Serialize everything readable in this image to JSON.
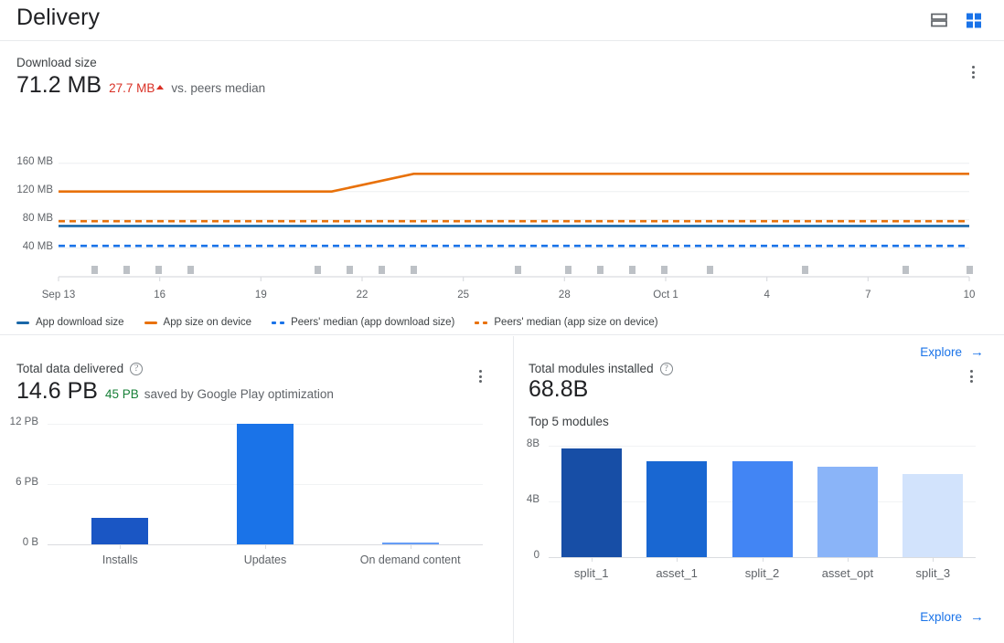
{
  "header": {
    "title": "Delivery",
    "view_toggles": [
      {
        "name": "list-view-toggle",
        "label": "List view",
        "selected": false
      },
      {
        "name": "grid-view-toggle",
        "label": "Grid view",
        "selected": true
      }
    ]
  },
  "download_size_card": {
    "label": "Download size",
    "value": "71.2 MB",
    "delta": "27.7 MB",
    "delta_direction": "up",
    "delta_note": "vs. peers median",
    "menu_label": "More options",
    "explore_label": "Explore",
    "explore_arrow": "→"
  },
  "total_data_card": {
    "label": "Total data delivered",
    "help_label": "?",
    "value": "14.6 PB",
    "saved": "45 PB",
    "saved_note": "saved by Google Play optimization",
    "menu_label": "More options"
  },
  "total_modules_card": {
    "label": "Total modules installed",
    "help_label": "?",
    "value": "68.8B",
    "subtitle": "Top 5 modules",
    "menu_label": "More options",
    "explore_label": "Explore",
    "explore_arrow": "→"
  },
  "colors": {
    "app_download_size": "#1a73e8",
    "app_download_size_line": "#1967a8",
    "app_size_on_device": "#e8710a",
    "peers_median_download": "#1a73e8",
    "peers_median_device": "#e8710a",
    "accent_blue": "#1a73e8",
    "negative_red": "#d93025",
    "positive_green": "#188038",
    "gridline": "#f1f3f4",
    "bar_installs": "#1a56c4",
    "bar_updates": "#1a73e8",
    "bar_ondemand": "#669df6",
    "module_colors": [
      "#174ea6",
      "#1967d2",
      "#4285f4",
      "#8ab4f8",
      "#d2e3fc"
    ]
  },
  "chart_data": [
    {
      "type": "line",
      "name": "download-size-over-time",
      "title": "Download size",
      "xlabel": "",
      "ylabel": "",
      "ylim": [
        20,
        170
      ],
      "yticks": [
        40,
        80,
        120,
        160
      ],
      "ytick_labels": [
        "40 MB",
        "80 MB",
        "120 MB",
        "160 MB"
      ],
      "xtick_labels": [
        "Sep 13",
        "16",
        "19",
        "22",
        "25",
        "28",
        "Oct 1",
        "4",
        "7",
        "10"
      ],
      "grid": true,
      "legend_position": "bottom-left",
      "series": [
        {
          "name": "App download size",
          "style": "solid",
          "color": "#1967a8",
          "constant": 71.2
        },
        {
          "name": "App size on device",
          "style": "solid",
          "color": "#e8710a",
          "points": [
            [
              0,
              120
            ],
            [
              0.3,
              120
            ],
            [
              0.39,
              145
            ],
            [
              1,
              145
            ]
          ]
        },
        {
          "name": "Peers' median (app download size)",
          "style": "dashed",
          "color": "#1a73e8",
          "constant": 43
        },
        {
          "name": "Peers' median (app size on device)",
          "style": "dashed",
          "color": "#e8710a",
          "constant": 78
        }
      ],
      "release_markers_pct": [
        4.0,
        7.5,
        11.0,
        14.5,
        28.5,
        32.0,
        35.5,
        39.0,
        50.5,
        56.0,
        59.5,
        63.0,
        66.5,
        71.5,
        82.0,
        93.0,
        100.0
      ]
    },
    {
      "type": "bar",
      "name": "total-data-delivered",
      "title": "Total data delivered",
      "categories": [
        "Installs",
        "Updates",
        "On demand content"
      ],
      "values": [
        2.6,
        12.0,
        0.12
      ],
      "value_labels": [
        "2.6 PB",
        "12 PB",
        "0.12 PB"
      ],
      "colors": [
        "#1a56c4",
        "#1a73e8",
        "#669df6"
      ],
      "ylabel": "",
      "xlabel": "",
      "ylim": [
        0,
        12
      ],
      "yticks": [
        0,
        6,
        12
      ],
      "ytick_labels": [
        "0 B",
        "6 PB",
        "12 PB"
      ],
      "grid": true
    },
    {
      "type": "bar",
      "name": "top-5-modules",
      "title": "Top 5 modules",
      "categories": [
        "split_1",
        "asset_1",
        "split_2",
        "asset_opt",
        "split_3"
      ],
      "values": [
        7.8,
        6.9,
        6.9,
        6.5,
        6.0
      ],
      "colors": [
        "#174ea6",
        "#1967d2",
        "#4285f4",
        "#8ab4f8",
        "#d2e3fc"
      ],
      "ylabel": "",
      "xlabel": "",
      "ylim": [
        0,
        8
      ],
      "yticks": [
        0,
        4,
        8
      ],
      "ytick_labels": [
        "0",
        "4B",
        "8B"
      ],
      "grid": true
    }
  ]
}
